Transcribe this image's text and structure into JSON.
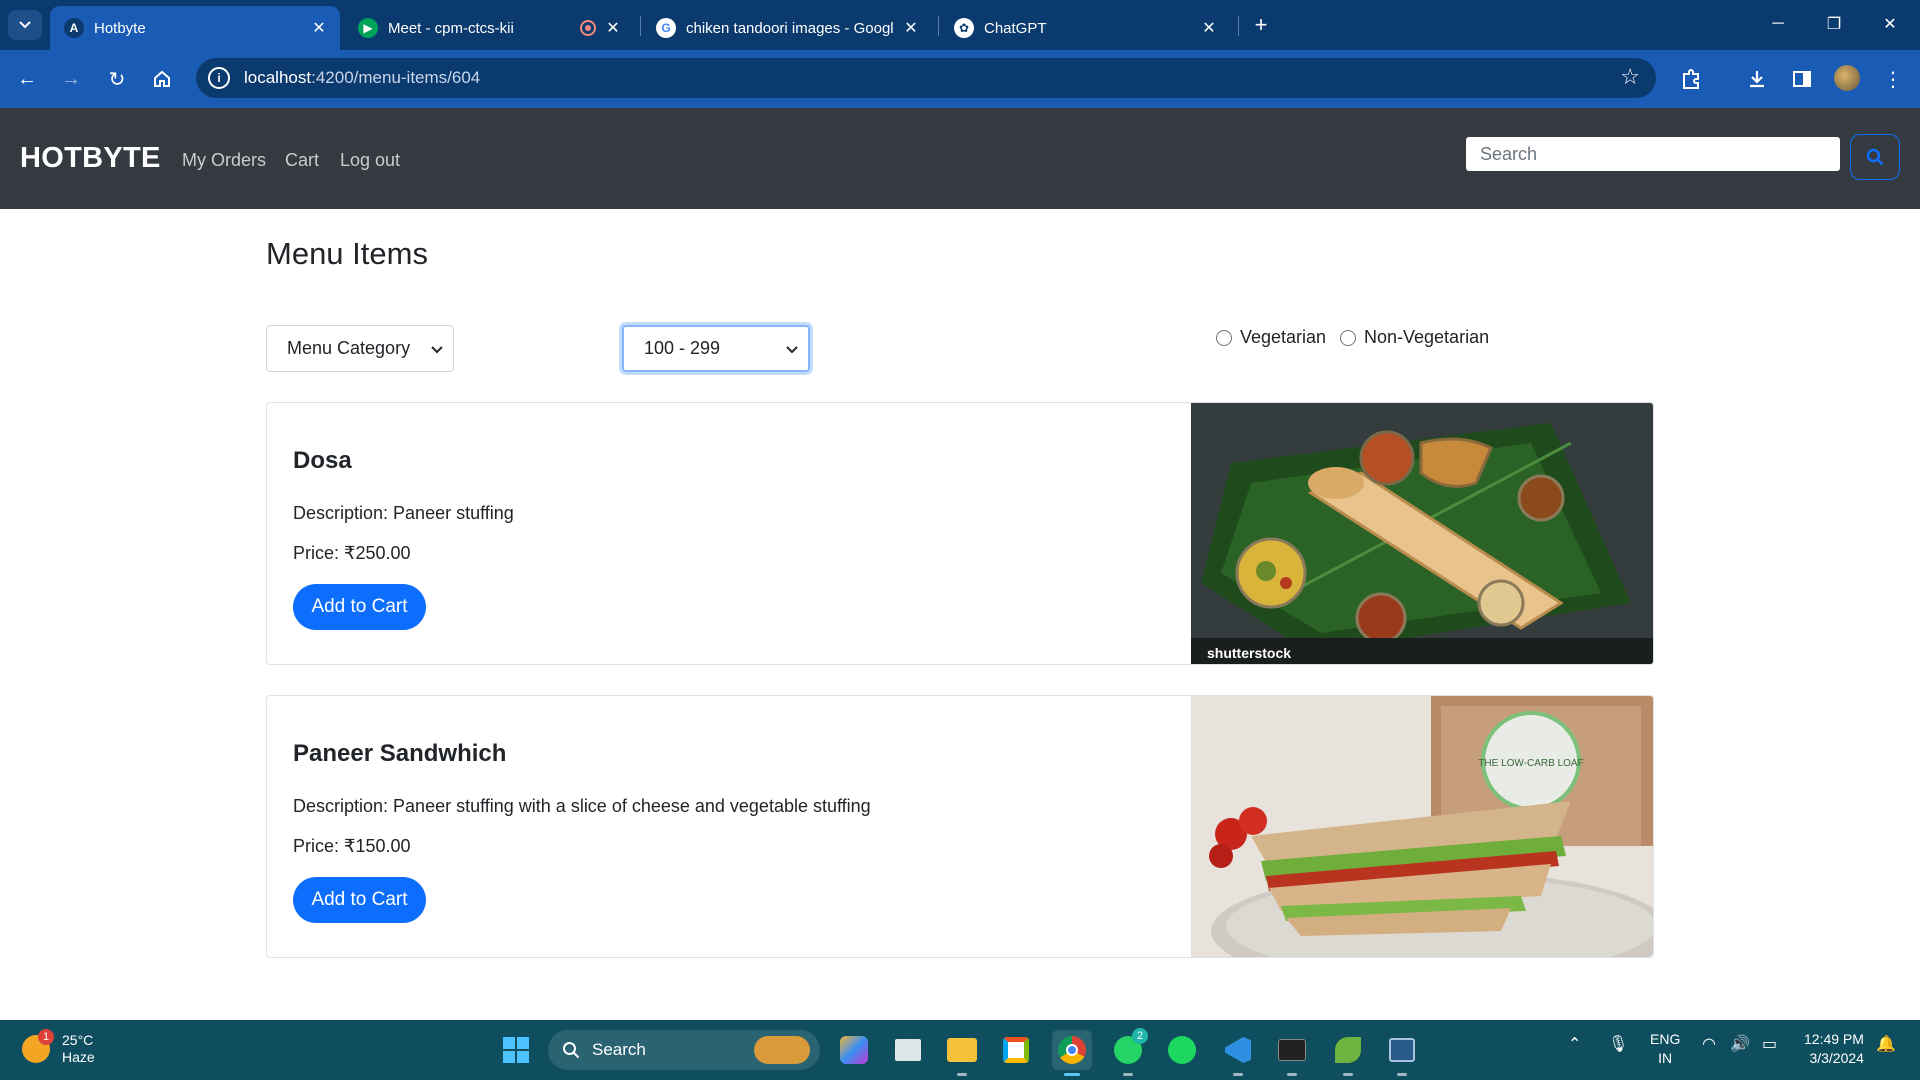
{
  "browser": {
    "tabs": [
      {
        "title": "Hotbyte",
        "active": true
      },
      {
        "title": "Meet - cpm-ctcs-kii",
        "active": false
      },
      {
        "title": "chiken tandoori images - Googl",
        "active": false
      },
      {
        "title": "ChatGPT",
        "active": false
      }
    ],
    "url_host": "localhost",
    "url_path": ":4200/menu-items/604"
  },
  "navbar": {
    "brand": "HOTBYTE",
    "links": [
      "My Orders",
      "Cart",
      "Log out"
    ],
    "search_placeholder": "Search"
  },
  "page": {
    "title": "Menu Items",
    "filters": {
      "category_selected": "Menu Category",
      "price_range_selected": "100 - 299",
      "diet_options": [
        "Vegetarian",
        "Non-Vegetarian"
      ]
    },
    "items": [
      {
        "name": "Dosa",
        "description": "Description: Paneer stuffing",
        "price": "Price: ₹250.00",
        "button": "Add to Cart",
        "image_watermark": "shutterstock"
      },
      {
        "name": "Paneer Sandwhich",
        "description": "Description: Paneer stuffing with a slice of cheese and vegetable stuffing",
        "price": "Price: ₹150.00",
        "button": "Add to Cart",
        "image_text": "THE LOW-CARB LOAF"
      }
    ]
  },
  "taskbar": {
    "weather_temp": "25°C",
    "weather_desc": "Haze",
    "weather_badge": "1",
    "search_label": "Search",
    "whatsapp_badge": "2",
    "lang_line1": "ENG",
    "lang_line2": "IN",
    "time": "12:49 PM",
    "date": "3/3/2024"
  },
  "colors": {
    "tabbar": "#0b3a6e",
    "toolbar": "#1a5bb5",
    "navbar": "#343a40",
    "primary": "#0d6efd",
    "taskbar": "#0f4e5e"
  }
}
